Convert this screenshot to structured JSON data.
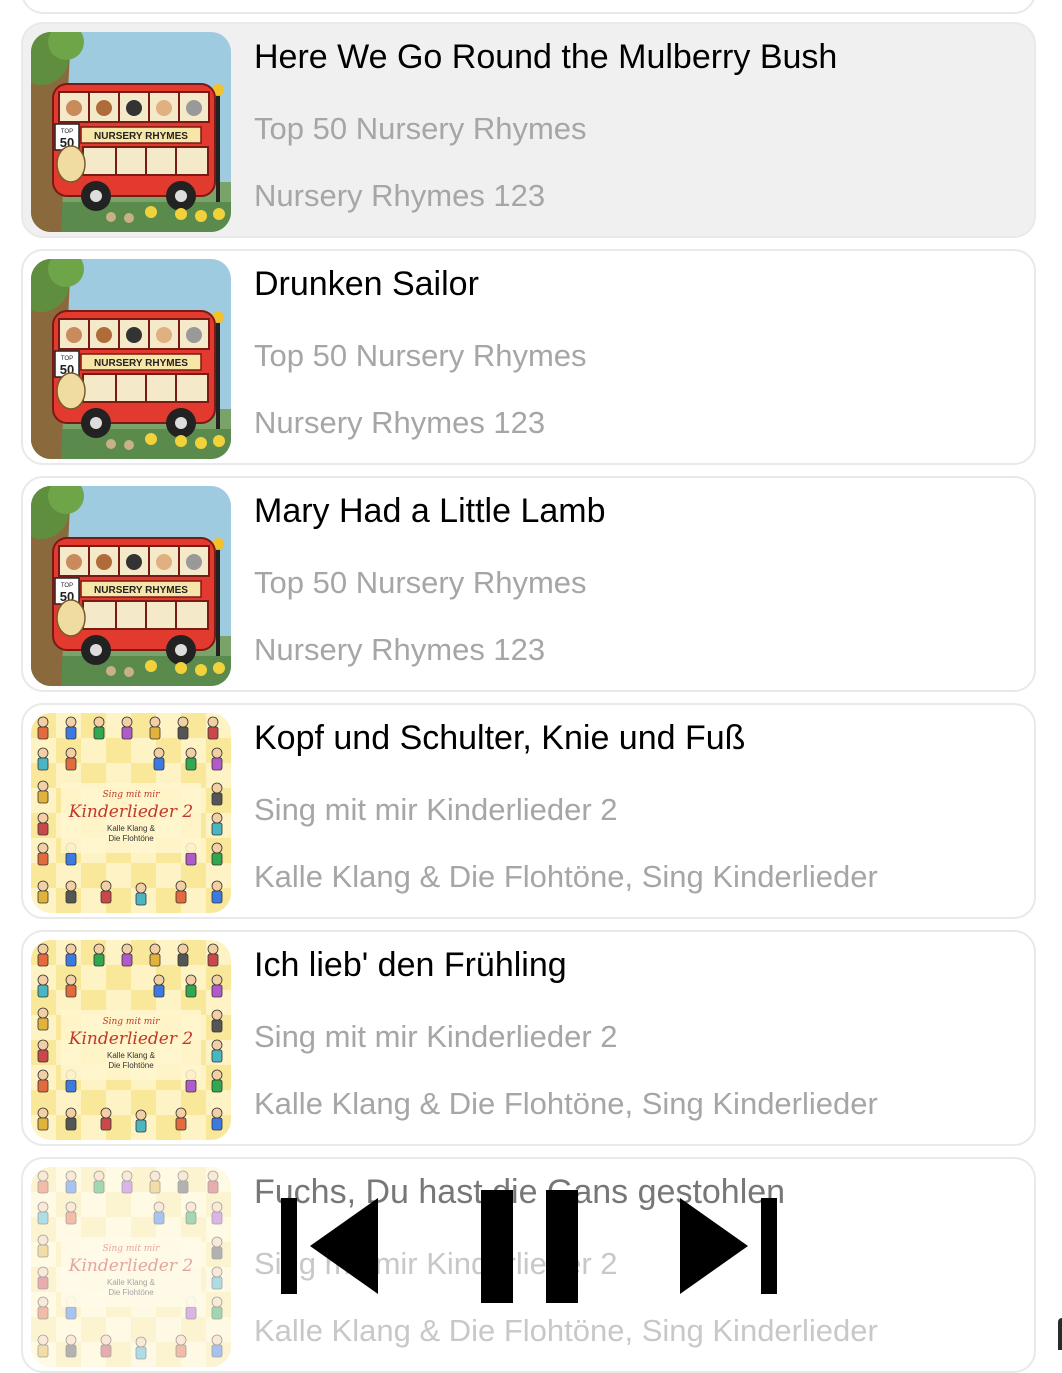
{
  "tracks": [
    {
      "title": "Here We Go Round the Mulberry Bush",
      "album": "Top 50 Nursery Rhymes",
      "artist": "Nursery Rhymes 123",
      "cover": "bus-cover",
      "active": true
    },
    {
      "title": "Drunken Sailor",
      "album": "Top 50 Nursery Rhymes",
      "artist": "Nursery Rhymes 123",
      "cover": "bus-cover",
      "active": false
    },
    {
      "title": "Mary Had a Little Lamb",
      "album": "Top 50 Nursery Rhymes",
      "artist": "Nursery Rhymes 123",
      "cover": "bus-cover",
      "active": false
    },
    {
      "title": "Kopf und Schulter, Knie und Fuß",
      "album": "Sing mit mir Kinderlieder 2",
      "artist": "Kalle Klang & Die Flohtöne, Sing Kinderlieder",
      "cover": "kinder-cover",
      "active": false
    },
    {
      "title": "Ich lieb' den Frühling",
      "album": "Sing mit mir Kinderlieder 2",
      "artist": "Kalle Klang & Die Flohtöne, Sing Kinderlieder",
      "cover": "kinder-cover",
      "active": false
    },
    {
      "title": "Fuchs, Du hast die Gans gestohlen",
      "album": "Sing mit mir Kinderlieder 2",
      "artist": "Kalle Klang & Die Flohtöne, Sing Kinderlieder",
      "cover": "kinder-cover",
      "active": false
    }
  ],
  "covers": {
    "bus": {
      "top_text": "TOP",
      "number": "50",
      "banner": "NURSERY RHYMES"
    },
    "kinder": {
      "line1": "Sing mit mir",
      "line2": "Kinderlieder 2",
      "line3": "Kalle Klang &",
      "line4": "Die Flohtöne"
    }
  },
  "controls": {
    "previous": "skip-previous-icon",
    "pause": "pause-icon",
    "next": "skip-next-icon"
  },
  "colors": {
    "active_row": "#f0f0f0",
    "title": "#000000",
    "subtitle": "#a6a6a6",
    "border": "#e9e9e9",
    "controls": "#000000"
  }
}
